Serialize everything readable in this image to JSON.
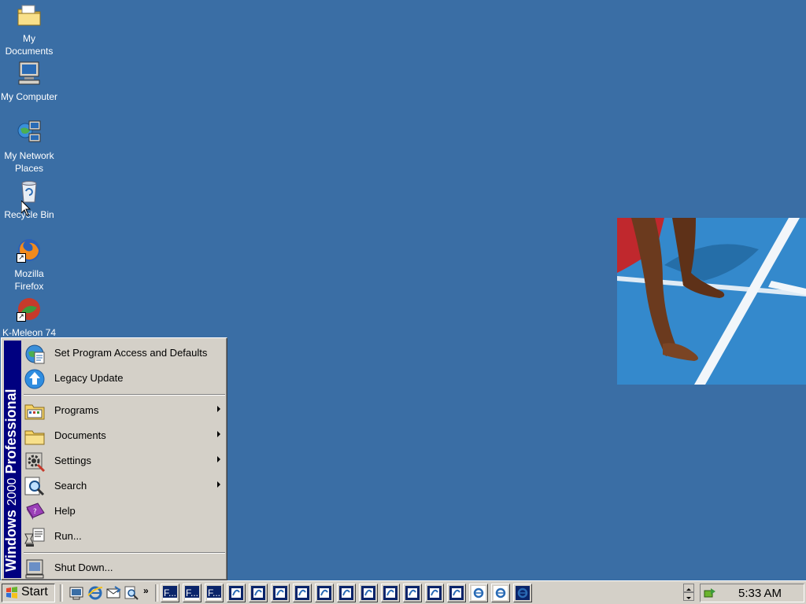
{
  "desktop": {
    "background_color": "#3a6ea5",
    "icons": [
      {
        "label": "My Documents",
        "icon": "my-documents-icon"
      },
      {
        "label": "My Computer",
        "icon": "my-computer-icon"
      },
      {
        "label": "My Network Places",
        "icon": "network-places-icon"
      },
      {
        "label": "Recycle Bin",
        "icon": "recycle-bin-icon"
      },
      {
        "label": "Mozilla Firefox",
        "icon": "firefox-icon"
      },
      {
        "label": "K-Meleon 74",
        "icon": "k-meleon-icon"
      }
    ]
  },
  "start_menu": {
    "banner_bold": "Windows",
    "banner_version": "2000",
    "banner_edition": "Professional",
    "top_items": [
      {
        "label": "Set Program Access and Defaults",
        "icon": "program-access-icon"
      },
      {
        "label": "Legacy Update",
        "icon": "legacy-update-icon"
      }
    ],
    "main_items": [
      {
        "label": "Programs",
        "icon": "programs-icon",
        "submenu": true
      },
      {
        "label": "Documents",
        "icon": "documents-folder-icon",
        "submenu": true
      },
      {
        "label": "Settings",
        "icon": "settings-icon",
        "submenu": true
      },
      {
        "label": "Search",
        "icon": "search-icon",
        "submenu": true
      },
      {
        "label": "Help",
        "icon": "help-icon",
        "submenu": false
      },
      {
        "label": "Run...",
        "icon": "run-icon",
        "submenu": false
      }
    ],
    "bottom_items": [
      {
        "label": "Shut Down...",
        "icon": "shut-down-icon"
      }
    ]
  },
  "taskbar": {
    "start_label": "Start",
    "chevron": "»",
    "quick_launch": [
      "show-desktop-icon",
      "internet-explorer-icon",
      "outlook-express-icon",
      "search-files-icon"
    ],
    "task_buttons": [
      {
        "label": "F...",
        "icon": "folder-window-icon"
      },
      {
        "label": "F...",
        "icon": "folder-window-icon"
      },
      {
        "label": "F...",
        "icon": "folder-window-icon"
      }
    ],
    "clock": "5:33 AM"
  }
}
